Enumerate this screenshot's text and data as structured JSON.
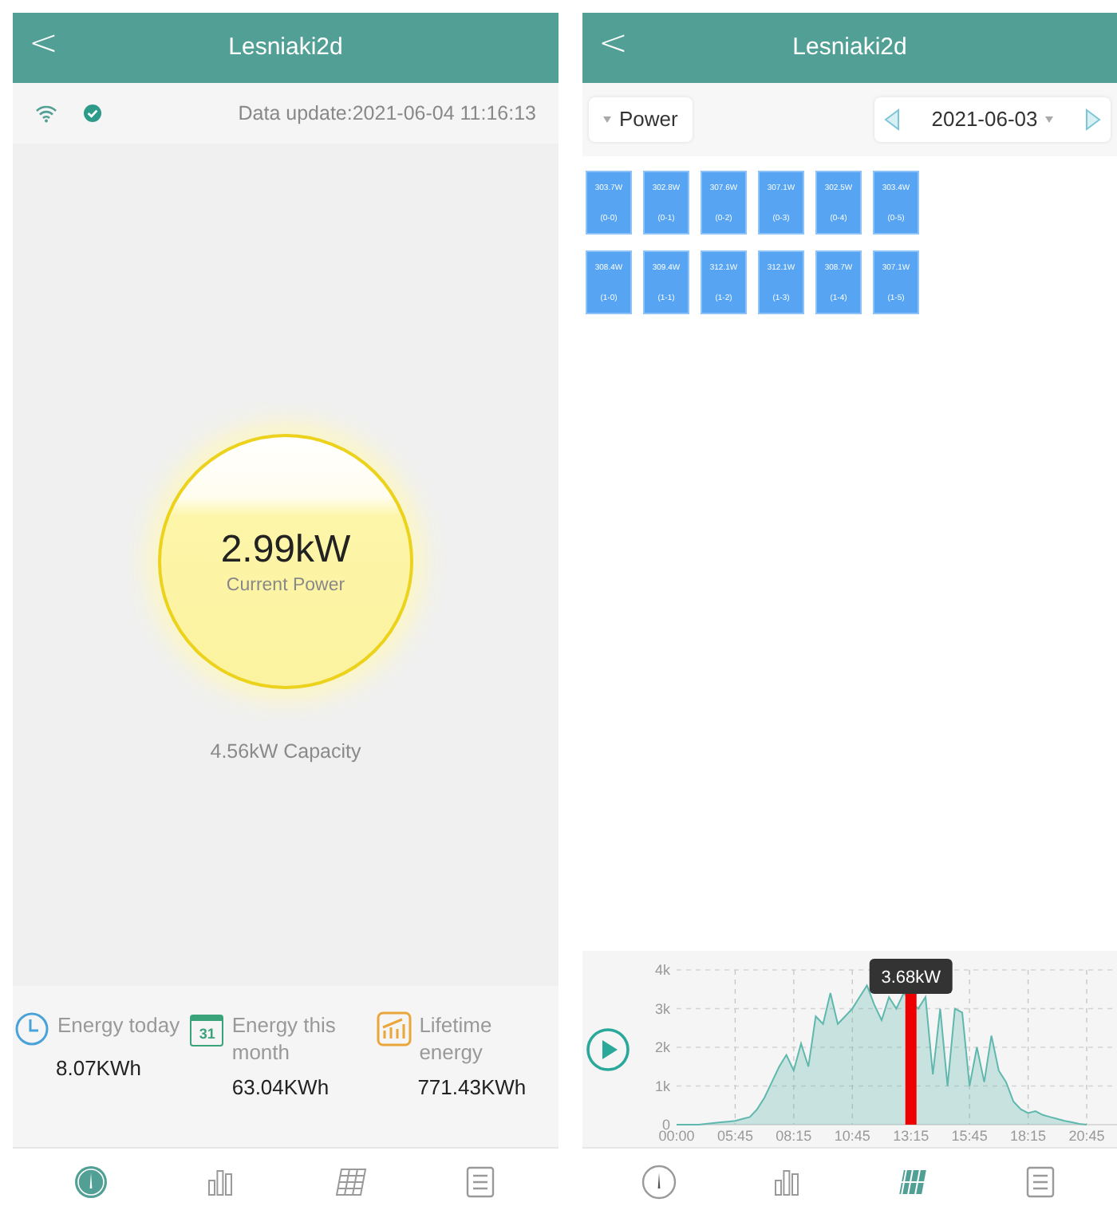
{
  "screens": [
    {
      "header": {
        "back": "<",
        "title": "Lesniaki2d"
      },
      "status": {
        "online": true,
        "update": "Data update:2021-06-04 11:16:13"
      },
      "current": {
        "value": "2.99kW",
        "label": "Current Power"
      },
      "capacity": "4.56kW Capacity",
      "stats": [
        {
          "kind": "clock",
          "label": "Energy today",
          "value": "8.07KWh"
        },
        {
          "kind": "calendar",
          "icon_text": "31",
          "label": "Energy this month",
          "value": "63.04KWh"
        },
        {
          "kind": "lifetime",
          "label": "Lifetime energy",
          "value": "771.43KWh"
        }
      ],
      "tabs": [
        {
          "kind": "gauge",
          "selected": true
        },
        {
          "kind": "bars",
          "selected": false
        },
        {
          "kind": "panels",
          "selected": false
        },
        {
          "kind": "list",
          "selected": false
        }
      ]
    },
    {
      "header": {
        "back": "<",
        "title": "Lesniaki2d"
      },
      "toolbar": {
        "metric": "Power",
        "date": "2021-06-03"
      },
      "panel_rows": [
        {
          "tiles": [
            {
              "power": "303.7W",
              "position": "(0-0)"
            },
            {
              "power": "302.8W",
              "position": "(0-1)"
            },
            {
              "power": "307.6W",
              "position": "(0-2)"
            },
            {
              "power": "307.1W",
              "position": "(0-3)"
            },
            {
              "power": "302.5W",
              "position": "(0-4)"
            },
            {
              "power": "303.4W",
              "position": "(0-5)"
            }
          ]
        },
        {
          "tiles": [
            {
              "power": "308.4W",
              "position": "(1-0)"
            },
            {
              "power": "309.4W",
              "position": "(1-1)"
            },
            {
              "power": "312.1W",
              "position": "(1-2)"
            },
            {
              "power": "312.1W",
              "position": "(1-3)"
            },
            {
              "power": "308.7W",
              "position": "(1-4)"
            },
            {
              "power": "307.1W",
              "position": "(1-5)"
            }
          ]
        }
      ],
      "chart": {
        "chart_data": {
          "type": "area",
          "categories": [
            "00:00",
            null,
            null,
            null,
            null,
            null,
            null,
            null,
            "05:45",
            null,
            null,
            null,
            null,
            null,
            null,
            null,
            "08:15",
            null,
            null,
            null,
            null,
            null,
            null,
            null,
            "10:45",
            null,
            null,
            null,
            null,
            null,
            null,
            null,
            "13:15",
            null,
            null,
            null,
            null,
            null,
            null,
            null,
            "15:45",
            null,
            null,
            null,
            null,
            null,
            null,
            null,
            "18:15",
            null,
            null,
            null,
            null,
            null,
            null,
            null,
            "20:45"
          ],
          "series": [
            {
              "color": "#5fb8ad",
              "values": [
                0,
                0,
                0,
                0,
                20,
                40,
                60,
                80,
                100,
                150,
                200,
                400,
                700,
                1100,
                1500,
                1800,
                1400,
                2100,
                1500,
                2800,
                2600,
                3400,
                2600,
                2800,
                3000,
                3300,
                3600,
                3100,
                2700,
                3300,
                3000,
                3400,
                null,
                3000,
                3300,
                1300,
                3000,
                1000,
                3000,
                2900,
                1000,
                2000,
                1100,
                2300,
                1400,
                1100,
                600,
                400,
                300,
                350,
                250,
                200,
                150,
                100,
                60,
                20,
                0
              ]
            }
          ],
          "ylim": [
            0,
            4000
          ],
          "grid": true,
          "yticks": [
            {
              "value": 0,
              "label": "0"
            },
            {
              "value": 1000,
              "label": "1k"
            },
            {
              "value": 2000,
              "label": "2k"
            },
            {
              "value": 3000,
              "label": "3k"
            },
            {
              "value": 4000,
              "label": "4k"
            }
          ],
          "annotations": [
            "3.68kW"
          ]
        }
      },
      "tabs": [
        {
          "kind": "gauge",
          "selected": false
        },
        {
          "kind": "bars",
          "selected": false
        },
        {
          "kind": "panels",
          "selected": true
        },
        {
          "kind": "list",
          "selected": false
        }
      ]
    }
  ]
}
